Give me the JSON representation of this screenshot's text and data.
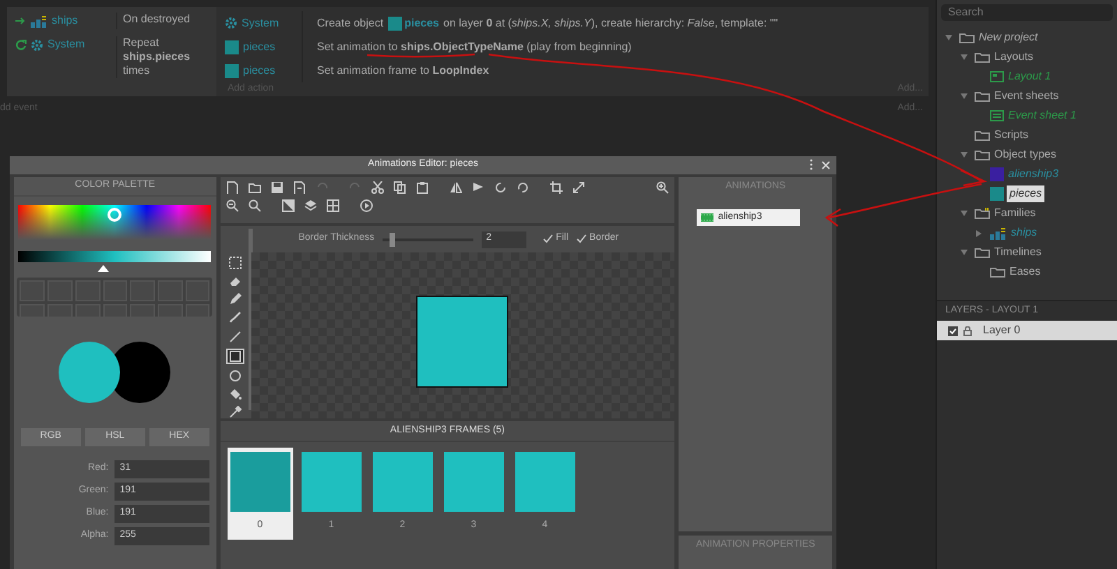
{
  "event": {
    "conditions": [
      {
        "kind": "trigger",
        "object": {
          "kind": "family",
          "name": "ships"
        },
        "text": "On destroyed"
      },
      {
        "kind": "loop",
        "object": {
          "kind": "system",
          "name": "System"
        },
        "text": "Repeat **ships.pieces** times"
      }
    ],
    "actions": [
      {
        "object": {
          "kind": "system",
          "name": "System"
        },
        "parts": [
          {
            "kind": "text",
            "text": "Create object"
          },
          {
            "kind": "object",
            "text": "pieces"
          },
          {
            "kind": "text",
            "text": "on layer **0** at (*ships.X, ships.Y*), create hierarchy: *False*, template: \"\""
          }
        ]
      },
      {
        "object": {
          "kind": "sprite",
          "name": "pieces"
        },
        "parts": [
          {
            "kind": "text",
            "text": "Set animation to **ships.ObjectTypeName** (play from beginning)"
          }
        ]
      },
      {
        "object": {
          "kind": "sprite",
          "name": "pieces"
        },
        "parts": [
          {
            "kind": "text",
            "text": "Set animation frame to **LoopIndex**"
          }
        ]
      }
    ],
    "add_action": "Add action",
    "add_link": "Add..."
  },
  "add_event": "dd event",
  "add_event_link": "Add...",
  "dialog": {
    "title": "Animations Editor: pieces",
    "palette": {
      "title": "COLOR PALETTE",
      "hue": {
        "level": 0.5
      },
      "shade": {
        "level": 0.44
      },
      "primary": {
        "color": "#1fbfbf"
      },
      "secondary": {
        "color": "#000000"
      },
      "modes": [
        {
          "label": "RGB"
        },
        {
          "label": "HSL"
        },
        {
          "label": "HEX"
        }
      ],
      "channels": [
        {
          "label": "Red:",
          "value": "31"
        },
        {
          "label": "Green:",
          "value": "191"
        },
        {
          "label": "Blue:",
          "value": "191"
        },
        {
          "label": "Alpha:",
          "value": "255"
        }
      ]
    },
    "tools": [
      {
        "selected": false
      },
      {
        "selected": false
      },
      {
        "selected": false
      },
      {
        "selected": false
      },
      {
        "selected": false
      },
      {
        "selected": true
      },
      {
        "selected": false
      },
      {
        "selected": false
      },
      {
        "selected": false
      }
    ],
    "options": {
      "label": "Border Thickness",
      "slider": {
        "level": 0.1
      },
      "value": "2",
      "checks": [
        {
          "label": "Fill",
          "checked": true
        },
        {
          "label": "Border",
          "checked": true
        }
      ]
    },
    "frames": {
      "title": "ALIENSHIP3 FRAMES (5)",
      "items": [
        {
          "label": "0",
          "selected": true
        },
        {
          "label": "1",
          "selected": false
        },
        {
          "label": "2",
          "selected": false
        },
        {
          "label": "3",
          "selected": false
        },
        {
          "label": "4",
          "selected": false
        }
      ]
    },
    "animations": {
      "title": "ANIMATIONS",
      "items": [
        {
          "label": "alienship3",
          "selected": true
        }
      ]
    },
    "properties": {
      "title": "ANIMATION PROPERTIES"
    }
  },
  "project": {
    "search": {
      "placeholder": "Search"
    },
    "tree": [
      {
        "label": "New project",
        "kind": "project",
        "expanded": true,
        "selected": false,
        "children": [
          {
            "label": "Layouts",
            "kind": "folder",
            "expanded": true,
            "selected": false,
            "children": [
              {
                "label": "Layout 1",
                "kind": "layout",
                "selected": false
              }
            ]
          },
          {
            "label": "Event sheets",
            "kind": "folder",
            "expanded": true,
            "selected": false,
            "children": [
              {
                "label": "Event sheet 1",
                "kind": "eventsheet",
                "selected": false
              }
            ]
          },
          {
            "label": "Scripts",
            "kind": "folder",
            "selected": false
          },
          {
            "label": "Object types",
            "kind": "folder",
            "expanded": true,
            "selected": false,
            "children": [
              {
                "label": "alienship3",
                "kind": "sprite",
                "color": "#3a1fa0",
                "selected": false
              },
              {
                "label": "pieces",
                "kind": "sprite",
                "color": "#1a8a8a",
                "selected": true
              }
            ]
          },
          {
            "label": "Families",
            "kind": "familyfolder",
            "expanded": true,
            "selected": false,
            "children": [
              {
                "label": "ships",
                "kind": "family",
                "expanded": false,
                "selected": false
              }
            ]
          },
          {
            "label": "Timelines",
            "kind": "folder",
            "expanded": true,
            "selected": false,
            "children": [
              {
                "label": "Eases",
                "kind": "folder",
                "selected": false
              }
            ]
          }
        ]
      }
    ]
  },
  "layers": {
    "title": "LAYERS - LAYOUT 1",
    "items": [
      {
        "label": "Layer 0",
        "checked": true,
        "selected": true
      }
    ]
  }
}
